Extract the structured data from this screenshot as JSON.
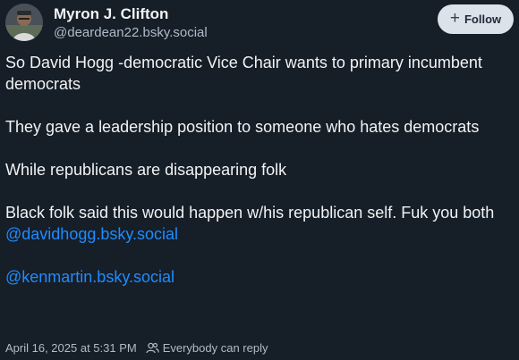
{
  "author": {
    "display_name": "Myron J. Clifton",
    "handle": "@deardean22.bsky.social",
    "avatar_icon": "avatar-photo"
  },
  "follow_button": {
    "label": "Follow",
    "icon": "plus-icon"
  },
  "post": {
    "paragraphs": [
      "So David Hogg -democratic Vice Chair wants to primary incumbent democrats",
      "They gave a leadership position to someone who hates democrats",
      "While republicans are disappearing folk",
      "Black folk said this would happen w/his republican self. Fuk you both"
    ],
    "mentions": [
      "@davidhogg.bsky.social",
      "@kenmartin.bsky.social"
    ]
  },
  "footer": {
    "timestamp": "April 16, 2025 at 5:31 PM",
    "reply_setting": "Everybody can reply",
    "reply_icon": "people-icon"
  },
  "colors": {
    "background": "#161e27",
    "text": "#f1f3f5",
    "muted": "#aebbc9",
    "link": "#208bfe",
    "button_bg": "#dce2ea"
  }
}
